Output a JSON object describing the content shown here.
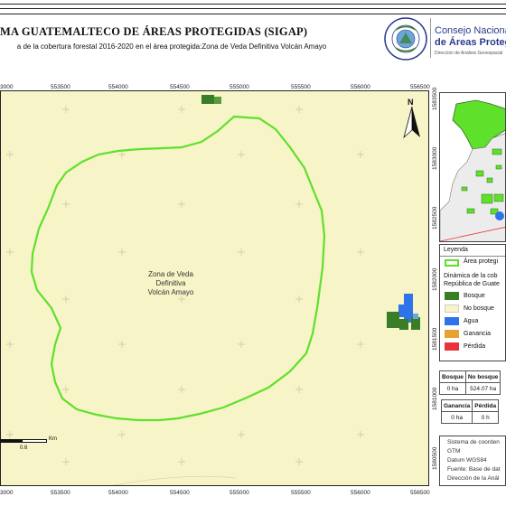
{
  "header": {
    "title": "MA GUATEMALTECO DE ÁREAS PROTEGIDAS  (SIGAP)",
    "subtitle": "a de la cobertura forestal 2016-2020 en el área protegida:Zona de Veda Definitiva Volcán Amayo"
  },
  "logo": {
    "seal_text": "GOBIERNO DE LA REPÚBLICA · GUATEMALA",
    "line1": "Consejo Nacional",
    "line2": "de Áreas Protegid",
    "line3": "Dirección de Análisis Geoespacial"
  },
  "map": {
    "x_ticks_top": [
      "3000",
      "553500",
      "554000",
      "554500",
      "555000",
      "555500",
      "556000",
      "556500"
    ],
    "x_ticks_bottom": [
      "3000",
      "553500",
      "554000",
      "554500",
      "555000",
      "555500",
      "556000",
      "556500"
    ],
    "y_ticks_right": [
      "1583500",
      "1583000",
      "1582500",
      "1582000",
      "1581500",
      "1581000",
      "1580500"
    ],
    "area_label_line1": "Zona de Veda",
    "area_label_line2": "Definitiva",
    "area_label_line3": "Volcán Amayo",
    "north_label": "N",
    "scale_unit": "Km",
    "scale_value": "0.6"
  },
  "legend": {
    "title": "Leyenda",
    "protected_area": "Área protegi",
    "dynamics_line1": "Dinámica de la cob",
    "dynamics_line2": "República de Guate",
    "classes": [
      {
        "label": "Bosque",
        "color": "#3a7d28"
      },
      {
        "label": "No bosque",
        "color": "#f7f4c8"
      },
      {
        "label": "Agua",
        "color": "#2f73ea"
      },
      {
        "label": "Ganancia",
        "color": "#e6a233"
      },
      {
        "label": "Pérdida",
        "color": "#e8333a"
      }
    ]
  },
  "table1": {
    "headers": [
      "Bosque",
      "No bosque"
    ],
    "values": [
      "0 ha",
      "524.07 ha"
    ]
  },
  "table2": {
    "headers": [
      "Ganancia",
      "Pérdida"
    ],
    "values": [
      "0 ha",
      "0 h"
    ]
  },
  "notes": {
    "line1": "Sistema de coorden",
    "line2": "GTM",
    "line3": "Datum WGS84",
    "line4": "Fuente: Base de dat",
    "line5": "Dirección de la Anál"
  },
  "colors": {
    "background": "#f7f4c8",
    "boundary": "#5fe02b",
    "forest": "#3a7d28",
    "water": "#2f73ea",
    "gain": "#e6a233",
    "loss": "#e8333a"
  }
}
